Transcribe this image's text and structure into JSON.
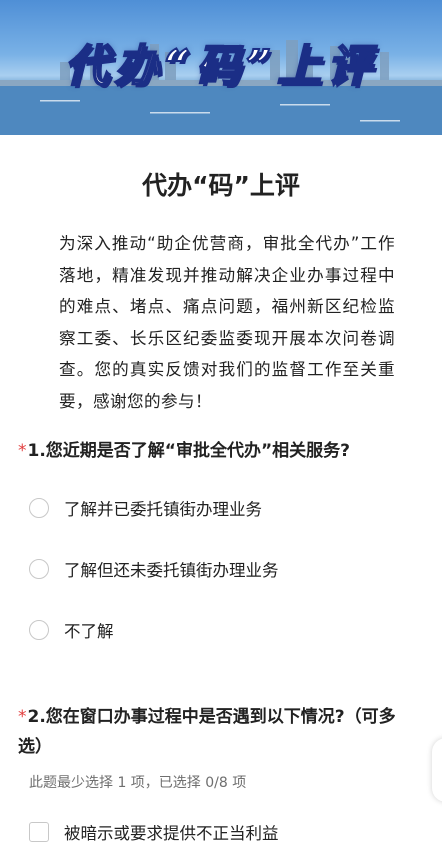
{
  "banner": {
    "title": "代办“码”上评"
  },
  "page_title": "代办“码”上评",
  "intro": "为深入推动“助企优营商，审批全代办”工作落地，精准发现并推动解决企业办事过程中的难点、堵点、痛点问题，福州新区纪检监察工委、长乐区纪委监委现开展本次问卷调查。您的真实反馈对我们的监督工作至关重要，感谢您的参与！",
  "questions": [
    {
      "required_mark": "*",
      "title": "1.您近期是否了解“审批全代办”相关服务?",
      "options": [
        "了解并已委托镇街办理业务",
        "了解但还未委托镇街办理业务",
        "不了解"
      ]
    },
    {
      "required_mark": "*",
      "title": "2.您在窗口办事过程中是否遇到以下情况?（可多选）",
      "hint": "此题最少选择 1 项，已选择 0/8 项",
      "options": [
        "被暗示或要求提供不正当利益"
      ]
    }
  ]
}
